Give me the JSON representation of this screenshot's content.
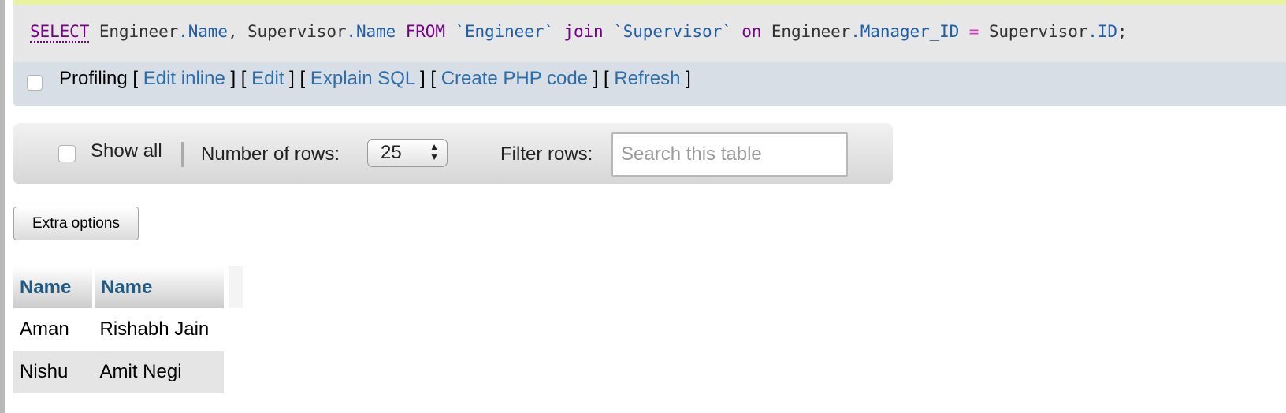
{
  "query": {
    "tokens": [
      {
        "t": "SELECT",
        "c": "kw kw-under"
      },
      {
        "t": " ",
        "c": "var"
      },
      {
        "t": "Engineer",
        "c": "var"
      },
      {
        "t": ".Name",
        "c": "prop"
      },
      {
        "t": ", ",
        "c": "var"
      },
      {
        "t": "Supervisor",
        "c": "var"
      },
      {
        "t": ".Name",
        "c": "prop"
      },
      {
        "t": " ",
        "c": "var"
      },
      {
        "t": "FROM",
        "c": "kw"
      },
      {
        "t": " ",
        "c": "var"
      },
      {
        "t": "`Engineer`",
        "c": "str"
      },
      {
        "t": " ",
        "c": "var"
      },
      {
        "t": "join",
        "c": "kw"
      },
      {
        "t": " ",
        "c": "var"
      },
      {
        "t": "`Supervisor`",
        "c": "str"
      },
      {
        "t": " ",
        "c": "var"
      },
      {
        "t": "on",
        "c": "kw"
      },
      {
        "t": " ",
        "c": "var"
      },
      {
        "t": "Engineer",
        "c": "var"
      },
      {
        "t": ".Manager_ID",
        "c": "prop"
      },
      {
        "t": " ",
        "c": "var"
      },
      {
        "t": "=",
        "c": "op"
      },
      {
        "t": " ",
        "c": "var"
      },
      {
        "t": "Supervisor",
        "c": "var"
      },
      {
        "t": ".ID",
        "c": "prop"
      },
      {
        "t": ";",
        "c": "var"
      }
    ]
  },
  "profiling": {
    "label": "Profiling",
    "links": {
      "edit_inline": "Edit inline",
      "edit": "Edit",
      "explain_sql": "Explain SQL",
      "create_php": "Create PHP code",
      "refresh": "Refresh"
    }
  },
  "navigation": {
    "show_all_label": "Show all",
    "rows_label": "Number of rows:",
    "rows_value": "25",
    "filter_label": "Filter rows:",
    "search_placeholder": "Search this table"
  },
  "extra_options_label": "Extra options",
  "results": {
    "columns": [
      "Name",
      "Name"
    ],
    "rows": [
      [
        "Aman",
        "Rishabh Jain"
      ],
      [
        "Nishu",
        "Amit Negi"
      ]
    ]
  }
}
